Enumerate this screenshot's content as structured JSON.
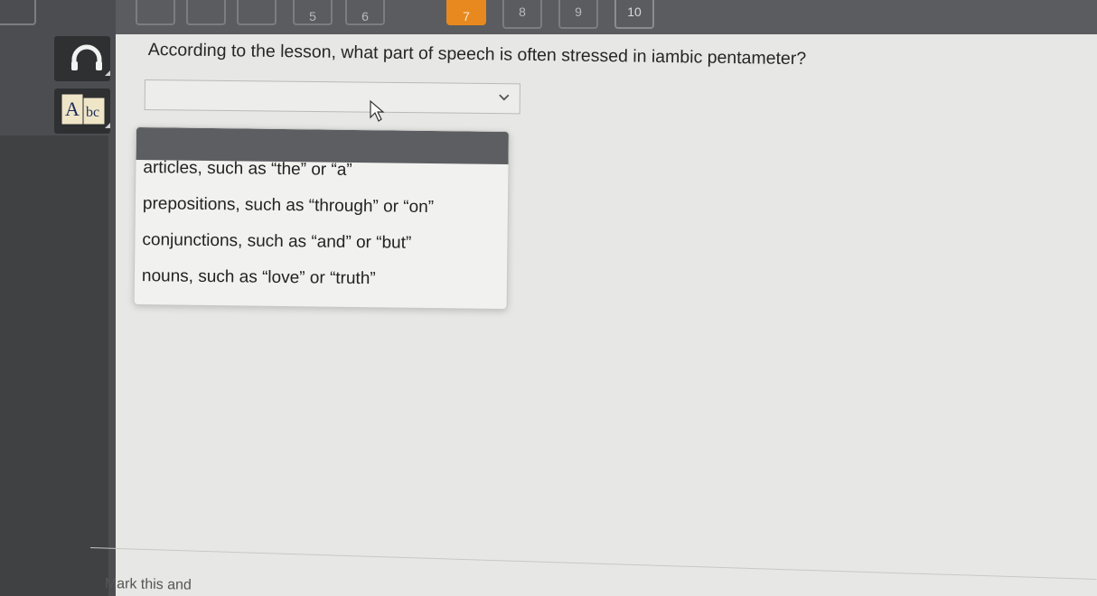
{
  "nav": {
    "questions": [
      {
        "label": "",
        "state": "done"
      },
      {
        "label": "",
        "state": "done"
      },
      {
        "label": "",
        "state": "done"
      },
      {
        "label": "",
        "state": "done"
      },
      {
        "label": "5",
        "state": "done"
      },
      {
        "label": "6",
        "state": "done"
      },
      {
        "label": "7",
        "state": "current"
      },
      {
        "label": "8",
        "state": "upcoming"
      },
      {
        "label": "9",
        "state": "upcoming"
      },
      {
        "label": "10",
        "state": "upcoming"
      }
    ]
  },
  "tools": {
    "audio_icon": "headphones-icon",
    "dictionary_icon": "dictionary-icon"
  },
  "question": {
    "text": "According to the lesson, what part of speech is often stressed in iambic pentameter?"
  },
  "dropdown": {
    "selected": "",
    "options": [
      "articles, such as “the” or “a”",
      "prepositions, such as “through” or “on”",
      "conjunctions, such as “and” or “but”",
      "nouns, such as “love” or “truth”"
    ]
  },
  "footer": {
    "mark_text": "Mark this and"
  },
  "colors": {
    "current_question": "#e8891f",
    "rail": "#4b4d50",
    "panel": "#e7e7e5"
  }
}
